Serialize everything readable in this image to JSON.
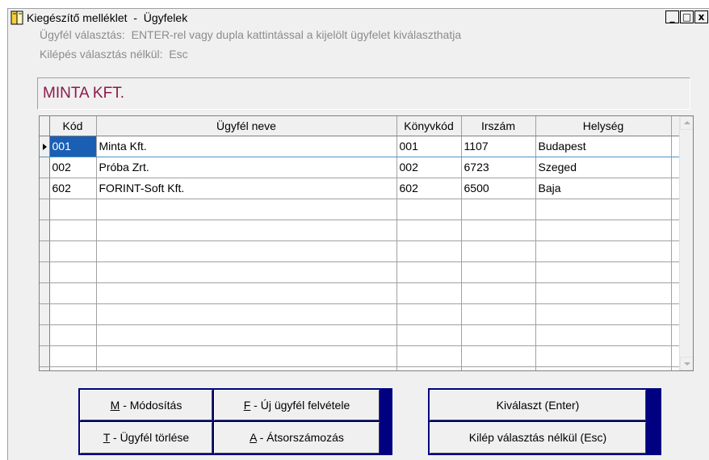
{
  "window": {
    "title": "Kiegészítő melléklet  -  Ügyfelek",
    "minimize_glyph": "_",
    "maximize_glyph": "□",
    "close_glyph": "x"
  },
  "hints": {
    "line1": "Ügyfél választás:  ENTER-rel vagy dupla kattintással a kijelölt ügyfelet kiválaszthatja",
    "line2": "Kilépés választás nélkül:  Esc"
  },
  "selected_client": "MINTA KFT.",
  "grid": {
    "columns": [
      "Kód",
      "Ügyfél neve",
      "Könyvkód",
      "Irszám",
      "Helység"
    ],
    "rows": [
      [
        "001",
        "Minta Kft.",
        "001",
        "1107",
        "Budapest"
      ],
      [
        "002",
        "Próba Zrt.",
        "002",
        "6723",
        "Szeged"
      ],
      [
        "602",
        "FORINT-Soft Kft.",
        "602",
        "6500",
        "Baja"
      ]
    ],
    "current_row": 0
  },
  "buttons": {
    "modify": {
      "key": "M",
      "rest": " - Módosítás"
    },
    "new_client": {
      "key": "F",
      "rest": " - Új ügyfél felvétele"
    },
    "delete_client": {
      "key": "T",
      "rest": " - Ügyfél törlése"
    },
    "renumber": {
      "key": "A",
      "rest": " - Átsorszámozás"
    },
    "select": "Kiválaszt  (Enter)",
    "exit": "Kilép választás nélkül  (Esc)"
  },
  "colors": {
    "selected_client_text": "#8b1a4a",
    "button_frame": "#000080",
    "current_cell": "#1a5fb4"
  }
}
